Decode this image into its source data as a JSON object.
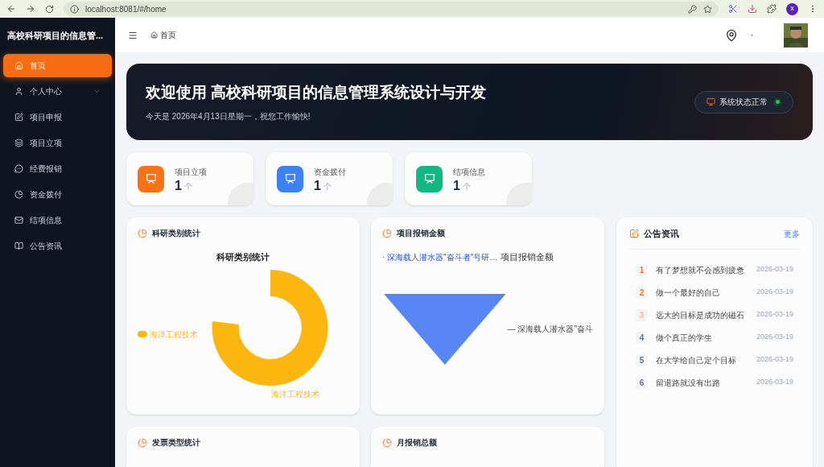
{
  "browser": {
    "url": "localhost:8081/#/home",
    "profile": "x"
  },
  "sidebar": {
    "title": "高校科研项目的信息管...",
    "items": [
      {
        "label": "首页",
        "selected": true,
        "expandable": false
      },
      {
        "label": "个人中心",
        "selected": false,
        "expandable": true
      },
      {
        "label": "项目申报",
        "selected": false,
        "expandable": false
      },
      {
        "label": "项目立项",
        "selected": false,
        "expandable": false
      },
      {
        "label": "经费报销",
        "selected": false,
        "expandable": false
      },
      {
        "label": "资金拨付",
        "selected": false,
        "expandable": false
      },
      {
        "label": "结项信息",
        "selected": false,
        "expandable": false
      },
      {
        "label": "公告资讯",
        "selected": false,
        "expandable": false
      }
    ]
  },
  "header": {
    "breadcrumb": "首页",
    "dot": "·"
  },
  "banner": {
    "title": "欢迎使用 高校科研项目的信息管理系统设计与开发",
    "subtitle": "今天是 2026年4月13日星期一，祝您工作愉快!",
    "status": "系统状态正常"
  },
  "stats": [
    {
      "label": "项目立项",
      "value": "1",
      "unit": "个",
      "color": "#f97316"
    },
    {
      "label": "资金拨付",
      "value": "1",
      "unit": "个",
      "color": "#3b82f6"
    },
    {
      "label": "结项信息",
      "value": "1",
      "unit": "个",
      "color": "#10b981"
    }
  ],
  "charts": [
    {
      "kind": "donut",
      "title": "科研类别统计",
      "chart_title": "科研类别统计",
      "legend": "海洋工程技术",
      "slice_label": "海洋工程技术",
      "color": "#fbb710"
    },
    {
      "kind": "funnel",
      "title": "项目报销金额",
      "chart_title": "项目报销金额",
      "legend": "· 深海载人潜水器\"奋斗者\"号研…",
      "slice_label": "— 深海载人潜水器\"奋斗",
      "color": "#5886f5"
    }
  ],
  "bottom_cards": [
    {
      "title": "发票类型统计"
    },
    {
      "title": "月报销总额"
    }
  ],
  "notices": {
    "title": "公告资讯",
    "more": "更多",
    "items": [
      {
        "rank": "1",
        "title": "有了梦想就不会感到疲惫",
        "date": "2026-03-19",
        "color": "#f97316"
      },
      {
        "rank": "2",
        "title": "做一个最好的自己",
        "date": "2026-03-19",
        "color": "#f97316"
      },
      {
        "rank": "3",
        "title": "远大的目标是成功的磁石",
        "date": "2026-03-19",
        "color": "#fdba74"
      },
      {
        "rank": "4",
        "title": "做个真正的学生",
        "date": "2026-03-19",
        "color": "#64748b"
      },
      {
        "rank": "5",
        "title": "在大学给自己定个目标",
        "date": "2026-03-19",
        "color": "#64748b"
      },
      {
        "rank": "6",
        "title": "留退路就没有出路",
        "date": "2026-03-19",
        "color": "#64748b"
      }
    ]
  }
}
